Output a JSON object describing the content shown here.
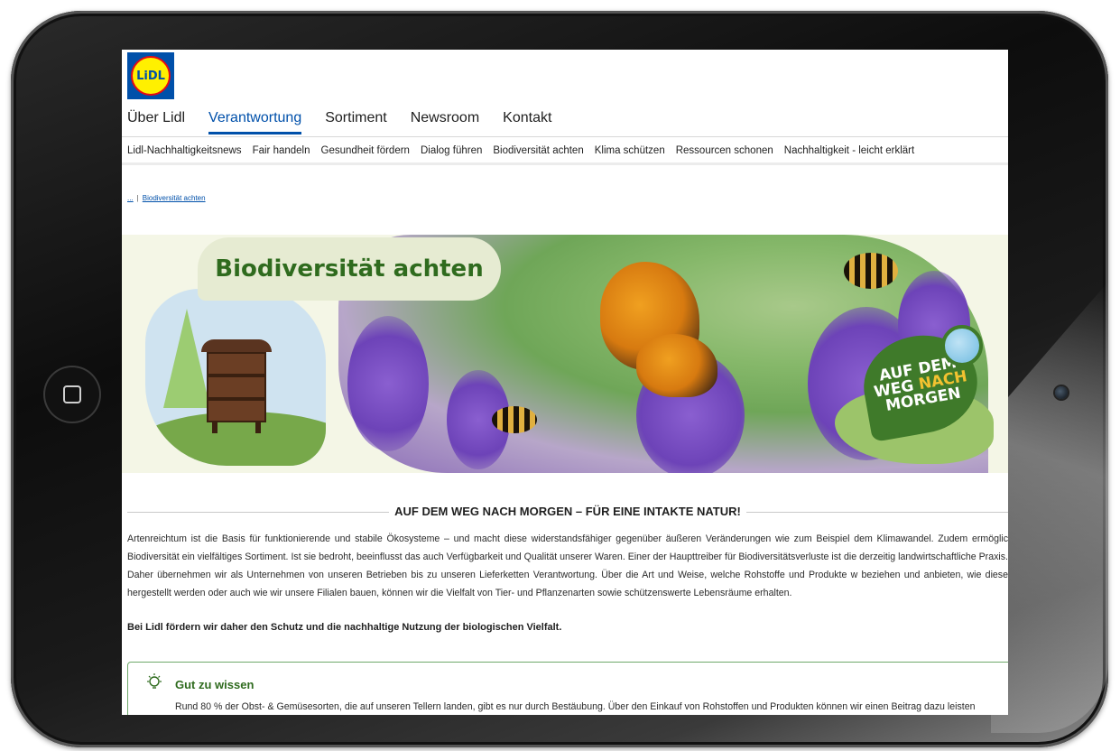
{
  "logo": {
    "text": "LiDL"
  },
  "main_nav": [
    {
      "label": "Über Lidl",
      "active": false
    },
    {
      "label": "Verantwortung",
      "active": true
    },
    {
      "label": "Sortiment",
      "active": false
    },
    {
      "label": "Newsroom",
      "active": false
    },
    {
      "label": "Kontakt",
      "active": false
    }
  ],
  "sub_nav": [
    "Lidl-Nachhaltigkeitsnews",
    "Fair handeln",
    "Gesundheit fördern",
    "Dialog führen",
    "Biodiversität achten",
    "Klima schützen",
    "Ressourcen schonen",
    "Nachhaltigkeit - leicht erklärt"
  ],
  "breadcrumb": {
    "root": "...",
    "separator": "|",
    "current": "Biodiversität achten"
  },
  "hero": {
    "title": "Biodiversität achten",
    "badge_line1": "AUF DEM",
    "badge_line2a": "WEG",
    "badge_line2b": "NACH",
    "badge_line3": "MORGEN"
  },
  "section": {
    "heading": "AUF DEM WEG NACH MORGEN – FÜR EINE INTAKTE NATUR!",
    "intro": "Artenreichtum ist die Basis für funktionierende und stabile Ökosysteme – und macht diese widerstandsfähiger gegenüber äußeren Veränderungen wie zum Beispiel dem Klimawandel. Zudem ermöglic Biodiversität ein vielfältiges Sortiment. Ist sie bedroht, beeinflusst das auch Verfügbarkeit und Qualität unserer Waren. Einer der Haupttreiber für Biodiversitätsverluste ist die derzeitig landwirtschaftliche Praxis. Daher übernehmen wir als Unternehmen von unseren Betrieben bis zu unseren Lieferketten Verantwortung. Über die Art und Weise, welche Rohstoffe und Produkte w beziehen und anbieten, wie diese hergestellt werden oder auch wie wir unsere Filialen bauen, können wir die Vielfalt von Tier- und Pflanzenarten sowie schützenswerte Lebensräume erhalten.",
    "bold_statement": "Bei Lidl fördern wir daher den Schutz und die nachhaltige Nutzung der biologischen Vielfalt."
  },
  "info_box": {
    "icon": "lightbulb-icon",
    "title": "Gut zu wissen",
    "text": "Rund 80 % der Obst- & Gemüsesorten, die auf unseren Tellern landen, gibt es nur durch Bestäubung. Über den Einkauf von Rohstoffen und Produkten können wir einen Beitrag dazu leisten"
  },
  "colors": {
    "brand_blue": "#0050aa",
    "brand_yellow": "#fff000",
    "brand_red": "#e60a14",
    "green_accent": "#2f6b1e"
  }
}
